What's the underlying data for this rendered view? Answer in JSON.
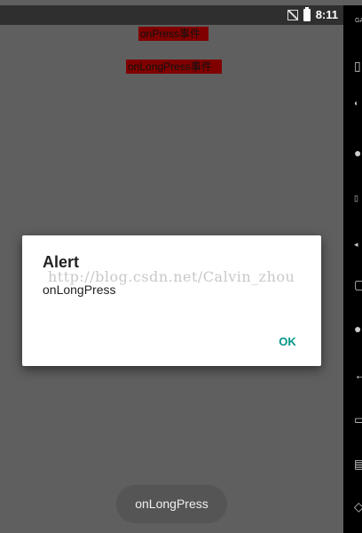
{
  "status_bar": {
    "time": "8:11",
    "icons": [
      "no-sim-icon",
      "battery-charging-icon"
    ]
  },
  "labels": {
    "on_press": "onPress事件",
    "on_long_press": "onLongPress事件"
  },
  "dialog": {
    "title": "Alert",
    "message": "onLongPress",
    "ok_label": "OK",
    "accent_color": "#009688"
  },
  "watermark": "http://blog.csdn.net/Calvin_zhou",
  "toast": {
    "text": "onLongPress"
  },
  "nav_side": {
    "gapps_label": "GA",
    "icons": [
      "gapps-icon",
      "wifi-icon",
      "camera-icon",
      "trash-icon",
      "volume-icon",
      "screen-icon",
      "dot-icon",
      "back-icon",
      "home-icon",
      "recent-apps-icon",
      "rotate-icon"
    ]
  },
  "colors": {
    "background": "#5f5f5f",
    "label_background": "#800000",
    "dialog_background": "#ffffff"
  }
}
